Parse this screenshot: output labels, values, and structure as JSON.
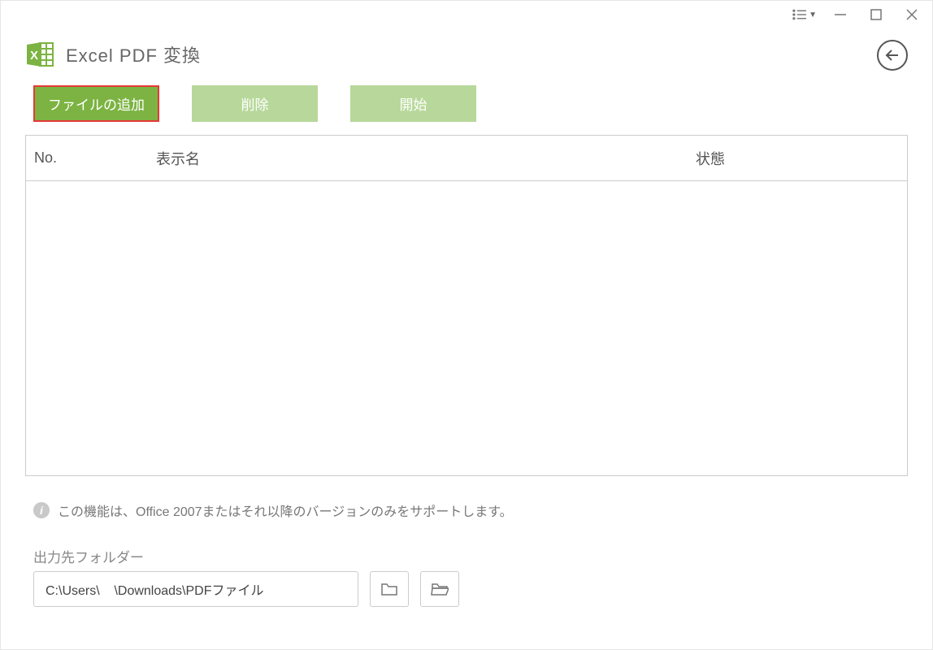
{
  "header": {
    "title": "Excel PDF 変換"
  },
  "toolbar": {
    "add_file": "ファイルの追加",
    "delete": "削除",
    "start": "開始"
  },
  "table": {
    "columns": {
      "no": "No.",
      "name": "表示名",
      "status": "状態"
    },
    "rows": []
  },
  "info": {
    "message": "この機能は、Office 2007またはそれ以降のバージョンのみをサポートします。"
  },
  "output": {
    "label": "出力先フォルダー",
    "path": "C:\\Users\\    \\Downloads\\PDFファイル"
  },
  "colors": {
    "primary": "#7cb342",
    "primary_light": "#b7d89a",
    "highlight_border": "#e53935"
  }
}
